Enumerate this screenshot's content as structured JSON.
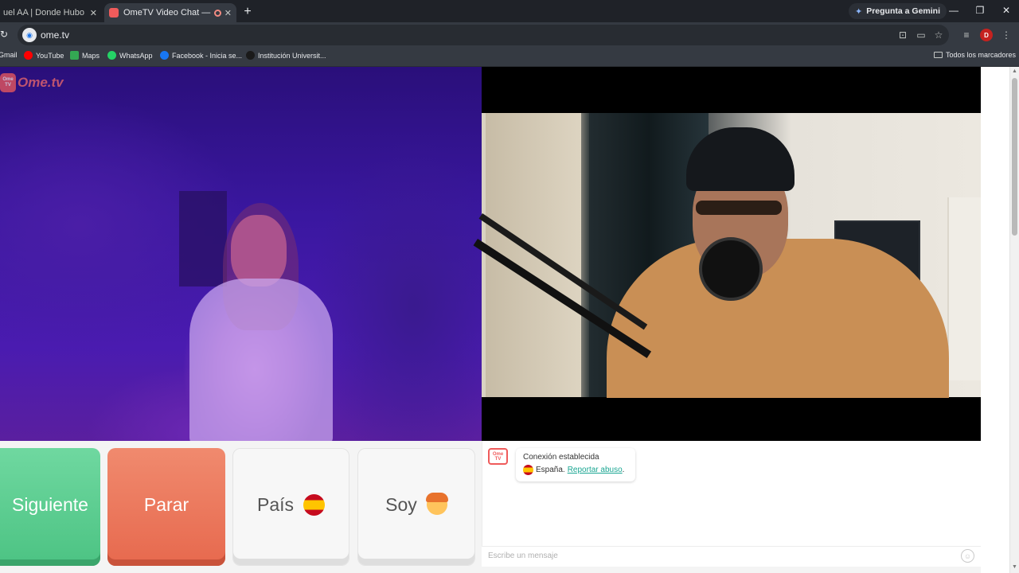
{
  "browser": {
    "tabs": [
      {
        "title": "uel AA | Donde Hubo Fuego",
        "active": false
      },
      {
        "title": "OmeTV Video Chat — Ome",
        "active": true
      }
    ],
    "close_glyph": "✕",
    "new_tab_glyph": "+",
    "gemini_label": "Pregunta a Gemini",
    "url": "ome.tv",
    "profile_initial": "D",
    "window_controls": [
      "—",
      "❐",
      "✕"
    ]
  },
  "bookmarks": {
    "items": [
      {
        "label": "Gmail",
        "icon": "gmail-icon"
      },
      {
        "label": "YouTube",
        "icon": "youtube-icon"
      },
      {
        "label": "Maps",
        "icon": "maps-icon"
      },
      {
        "label": "WhatsApp",
        "icon": "whatsapp-icon"
      },
      {
        "label": "Facebook - Inicia se...",
        "icon": "facebook-icon"
      },
      {
        "label": "Institución Universit...",
        "icon": "institution-icon"
      }
    ],
    "all_bookmarks_label": "Todos los marcadores"
  },
  "ometv": {
    "logo_text": "Ome.tv",
    "logo_box_text": "Ome TV",
    "buttons": {
      "next": "Siguiente",
      "stop": "Parar",
      "country": "País",
      "gender": "Soy"
    },
    "chat": {
      "status": "Conexión establecida",
      "country_name": "España.",
      "report_link": "Reportar abuso",
      "report_suffix": ".",
      "input_placeholder": "Escribe un mensaje"
    }
  },
  "colors": {
    "next_button": "#4cc383",
    "stop_button": "#e7694e",
    "brand_red": "#ef5b5b",
    "report_link": "#1aa692"
  }
}
